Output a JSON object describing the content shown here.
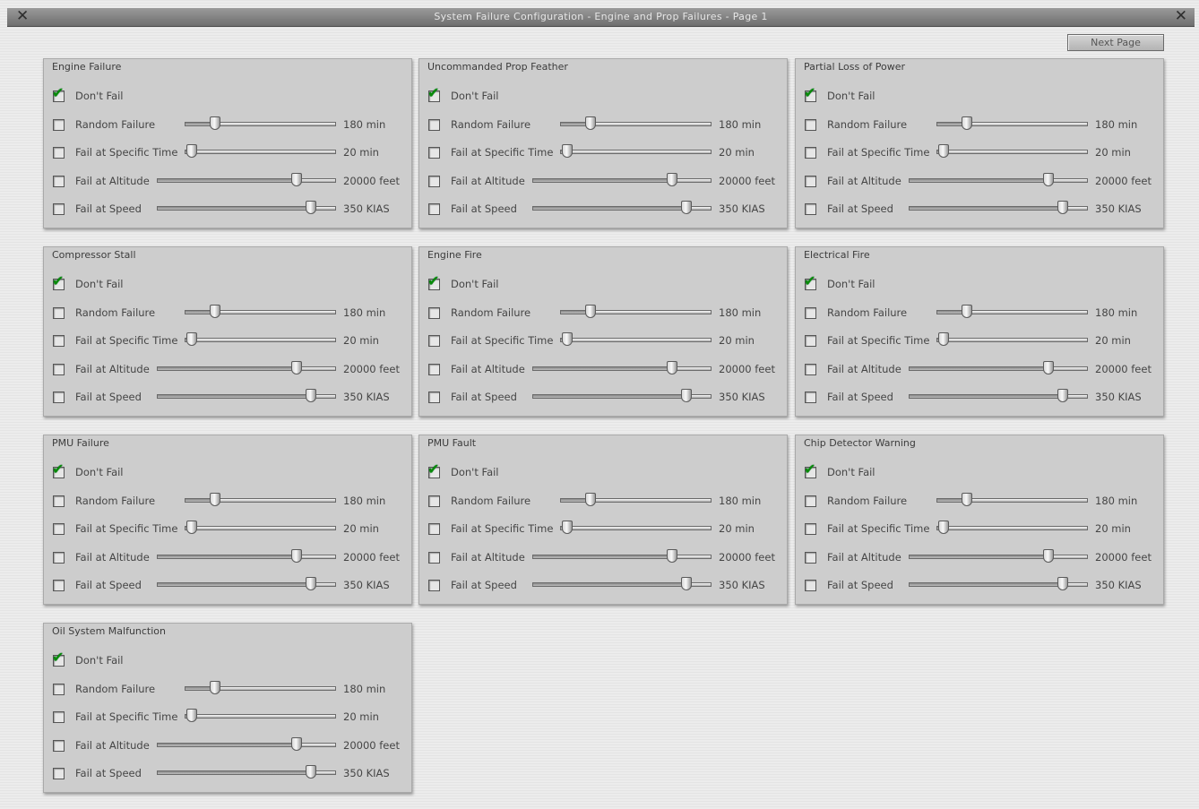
{
  "window": {
    "title": "System Failure Configuration - Engine and Prop Failures - Page 1",
    "next_page_label": "Next Page"
  },
  "rows": {
    "dont_fail": "Don't Fail",
    "random": "Random Failure",
    "specific_time": "Fail at Specific Time",
    "altitude": "Fail at Altitude",
    "speed": "Fail at Speed"
  },
  "values": {
    "random": "180 min",
    "specific_time": "20 min",
    "altitude": "20000 feet",
    "speed": "350 KIAS"
  },
  "slider_levels": {
    "random": 0.2,
    "specific_time": 0.05,
    "altitude": 0.78,
    "speed": 0.86
  },
  "colors": {
    "checkmark": "#0a8a0a",
    "panel_bg": "#cdcdcd",
    "titlebar": "#7a7a7a"
  },
  "panels": [
    {
      "title": "Engine Failure",
      "dont_fail_checked": true
    },
    {
      "title": "Uncommanded Prop Feather",
      "dont_fail_checked": true
    },
    {
      "title": "Partial Loss of Power",
      "dont_fail_checked": true
    },
    {
      "title": "Compressor Stall",
      "dont_fail_checked": true
    },
    {
      "title": "Engine Fire",
      "dont_fail_checked": true
    },
    {
      "title": "Electrical Fire",
      "dont_fail_checked": true
    },
    {
      "title": "PMU Failure",
      "dont_fail_checked": true
    },
    {
      "title": "PMU Fault",
      "dont_fail_checked": true
    },
    {
      "title": "Chip Detector Warning",
      "dont_fail_checked": true
    },
    {
      "title": "Oil System Malfunction",
      "dont_fail_checked": true
    }
  ]
}
